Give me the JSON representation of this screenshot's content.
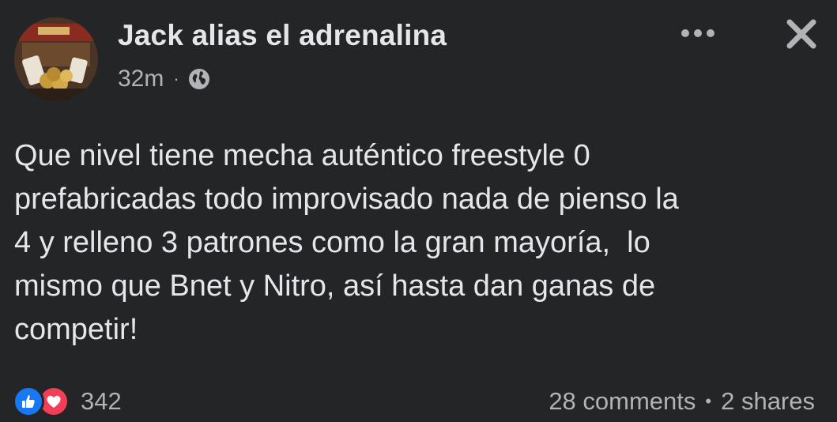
{
  "post": {
    "author": "Jack alias el adrenalina",
    "time": "32m",
    "meta_separator": "·",
    "privacy_icon": "globe-icon",
    "more_icon": "more-options-icon",
    "close_icon": "close-icon",
    "text": "Que nivel tiene mecha auténtico freestyle 0\nprefabricadas todo improvisado nada de pienso la\n4 y relleno 3 patrones como la gran mayoría,  lo\nmismo que Bnet y Nitro, así hasta dan ganas de\ncompetir!"
  },
  "footer": {
    "reactions": [
      "like",
      "love"
    ],
    "reaction_count": "342",
    "comments": "28 comments",
    "separator": "•",
    "shares": "2 shares"
  },
  "colors": {
    "background": "#242526",
    "primary_text": "#e4e6eb",
    "secondary_text": "#b0b3b8",
    "like": "#1877f2",
    "love": "#f33e58"
  }
}
